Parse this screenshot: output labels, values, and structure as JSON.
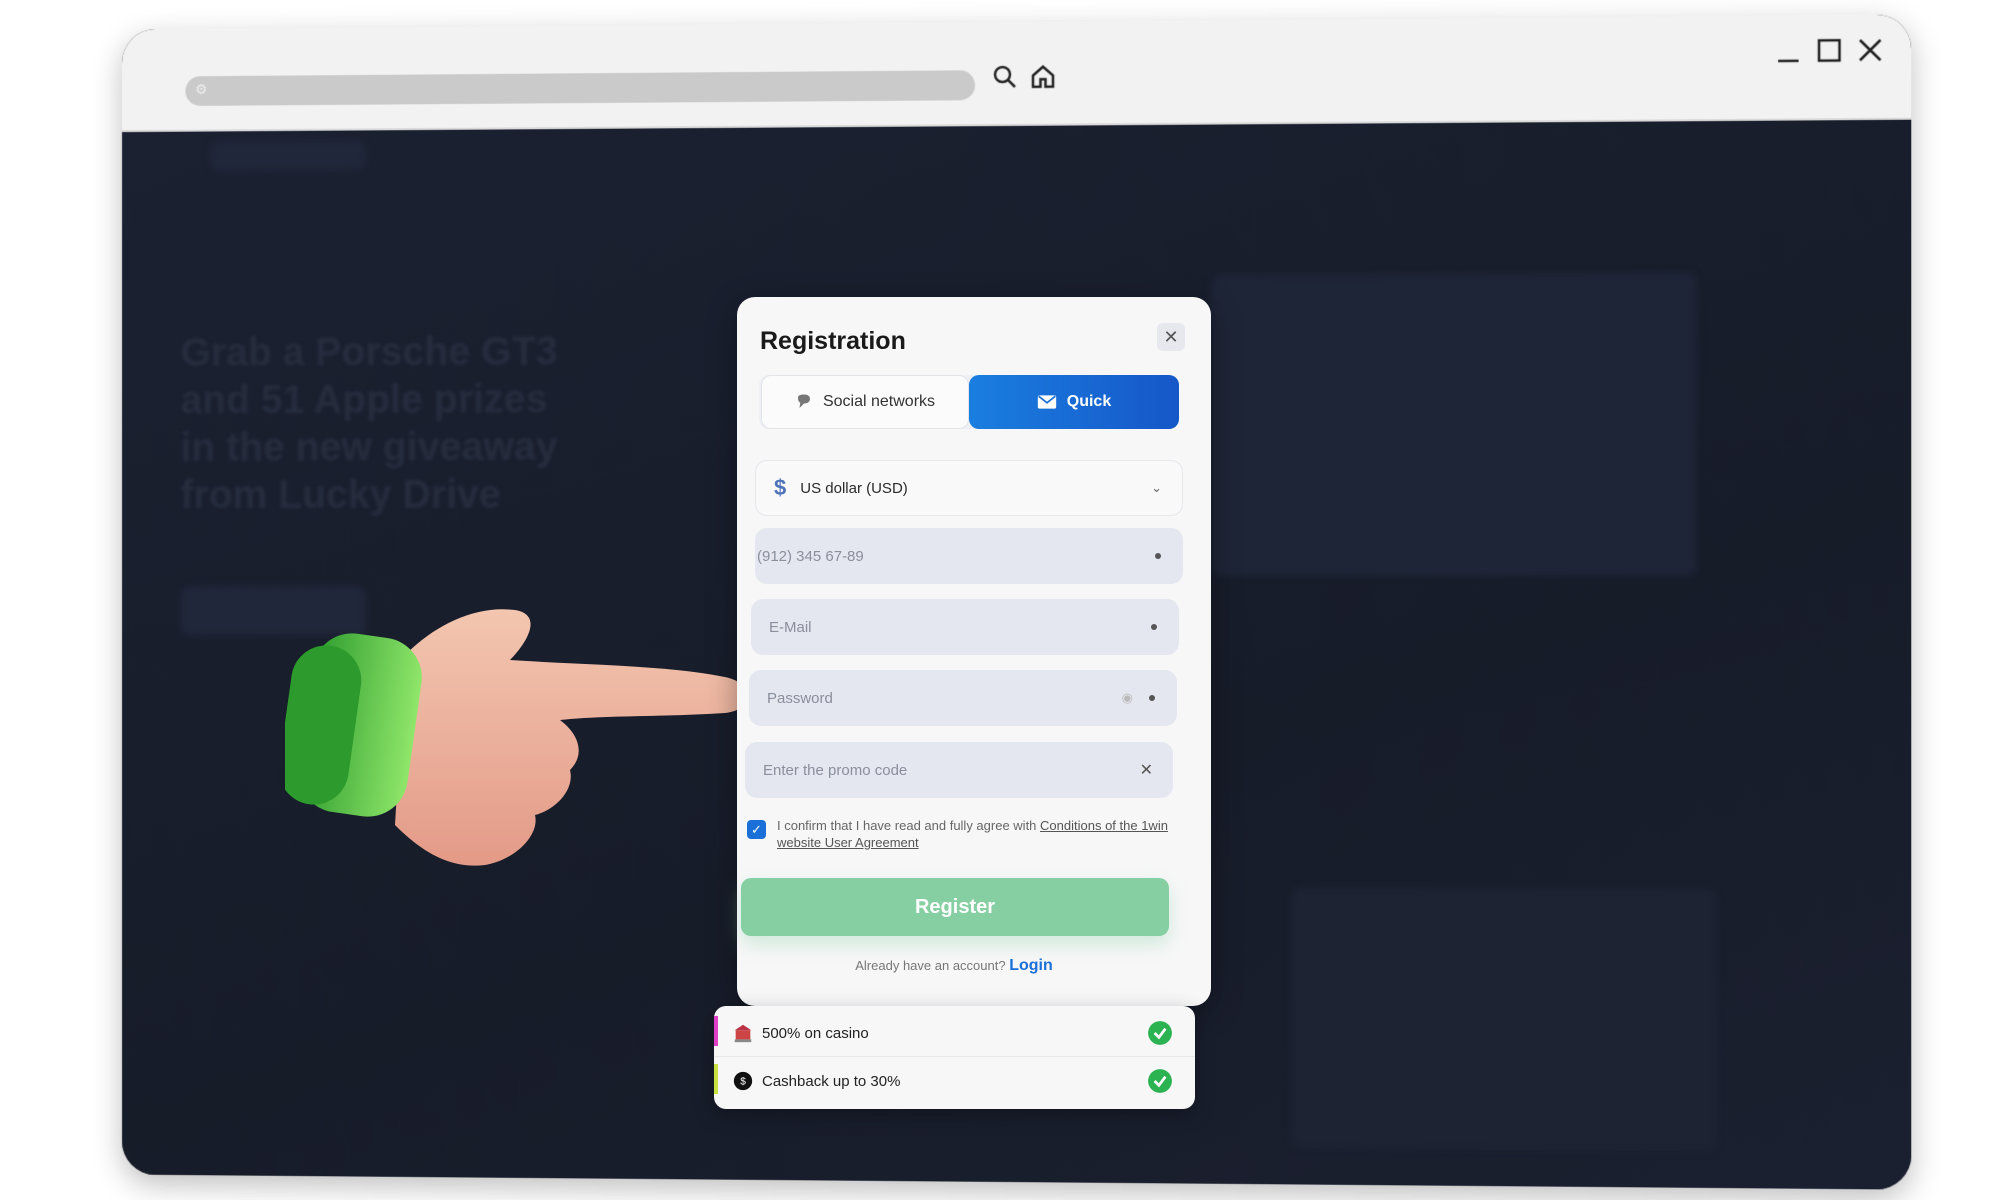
{
  "browser": {
    "toolbar_icons": [
      "search-icon",
      "home-icon"
    ],
    "window_controls": [
      "minimize-icon",
      "maximize-icon",
      "close-icon"
    ]
  },
  "background": {
    "headline": "Grab a Porsche GT3 and 51 Apple prizes in the new giveaway from Lucky Drive"
  },
  "modal": {
    "title": "Registration",
    "tabs": [
      {
        "label": "Social networks",
        "icon": "chat-bubble-icon",
        "active": false
      },
      {
        "label": "Quick",
        "icon": "envelope-icon",
        "active": true
      }
    ],
    "currency": {
      "value": "US dollar (USD)",
      "icon": "dollar-icon"
    },
    "phone": {
      "placeholder": "(912) 345 67-89"
    },
    "email": {
      "placeholder": "E-Mail"
    },
    "password": {
      "placeholder": "Password"
    },
    "promo": {
      "placeholder": "Enter the promo code"
    },
    "agreement": {
      "checked": true,
      "text": "I confirm that I have read and fully agree with ",
      "link": "Conditions of the 1win website User Agreement"
    },
    "register_label": "Register",
    "login_prompt": "Already have an account?",
    "login_link": "Login"
  },
  "bonuses": [
    {
      "label": "500% on casino",
      "icon": "casino-icon",
      "accent": "#e040c8"
    },
    {
      "label": "Cashback up to 30%",
      "icon": "cashback-icon",
      "accent": "#c8e040"
    }
  ],
  "colors": {
    "accent": "#1a6fd8",
    "register": "#86cfa3",
    "check": "#2bb352",
    "background": "#181d2a"
  }
}
